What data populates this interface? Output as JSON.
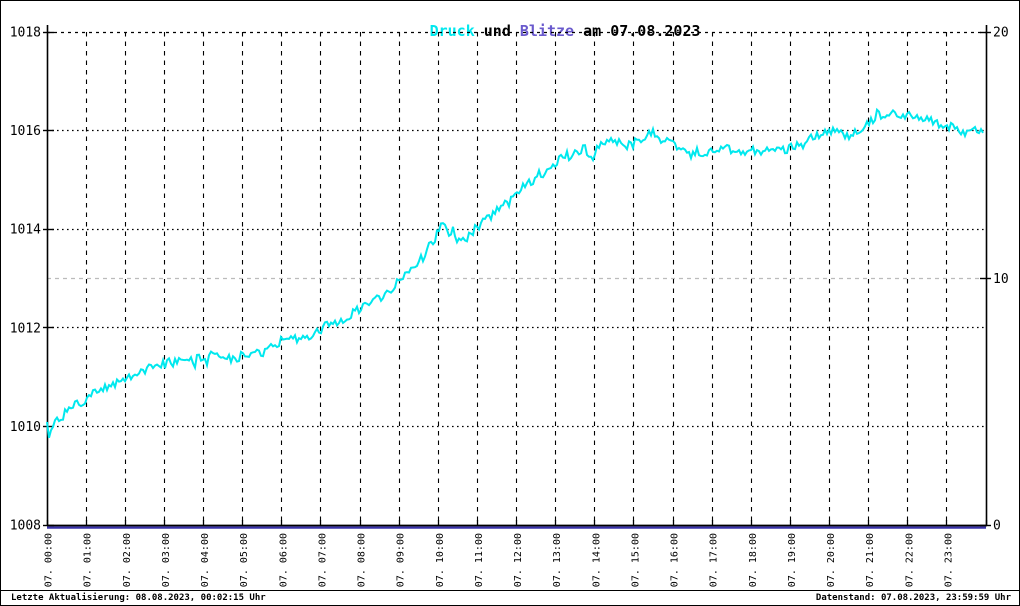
{
  "title": {
    "druck": "Druck",
    "und": " und ",
    "blitze": "Blitze",
    "date_suffix": " am 07.08.2023"
  },
  "footer": {
    "last_update": "Letzte Aktualisierung: 08.08.2023, 00:02:15 Uhr",
    "data_state": "Datenstand: 07.08.2023, 23:59:59 Uhr"
  },
  "colors": {
    "druck_accent": "#00E8EE",
    "blitze_accent": "#6A5ACD",
    "blitze_line": "#3832A8",
    "grid_major": "#000000",
    "grid_mid_gray": "#BBBBBB",
    "background": "#FFFFFF"
  },
  "chart_data": {
    "type": "line",
    "title": "Druck und Blitze am 07.08.2023",
    "x_range_hours": [
      0,
      24
    ],
    "x_hour_labels": [
      "07. 00:00",
      "07. 01:00",
      "07. 02:00",
      "07. 03:00",
      "07. 04:00",
      "07. 05:00",
      "07. 06:00",
      "07. 07:00",
      "07. 08:00",
      "07. 09:00",
      "07. 10:00",
      "07. 11:00",
      "07. 12:00",
      "07. 13:00",
      "07. 14:00",
      "07. 15:00",
      "07. 16:00",
      "07. 17:00",
      "07. 18:00",
      "07. 19:00",
      "07. 20:00",
      "07. 21:00",
      "07. 22:00",
      "07. 23:00"
    ],
    "y_left": {
      "range": [
        1008,
        1018
      ],
      "ticks": [
        1008,
        1010,
        1012,
        1014,
        1016,
        1018
      ]
    },
    "y_right": {
      "range": [
        0,
        20
      ],
      "ticks": [
        0,
        10,
        20
      ]
    },
    "grid": {
      "horizontal": "dotted-black",
      "vertical": "dashed-black-hourly",
      "right_mid_10": "dashed-light-gray"
    },
    "legend_position": "none",
    "noise_amplitude_hpa": 0.09,
    "series": [
      {
        "name": "Druck",
        "axis": "left",
        "color": "#00E8EE",
        "style": "noisy-line",
        "x_hours": [
          0,
          0.08,
          0.2,
          0.5,
          0.75,
          1.0,
          1.25,
          1.5,
          1.75,
          2.0,
          2.25,
          2.5,
          2.75,
          3.0,
          3.25,
          3.5,
          3.75,
          4.0,
          4.25,
          4.5,
          4.75,
          5.0,
          5.25,
          5.5,
          5.75,
          6.0,
          6.25,
          6.5,
          6.75,
          7.0,
          7.1,
          7.25,
          7.5,
          7.75,
          8.0,
          8.25,
          8.5,
          8.75,
          9.0,
          9.25,
          9.5,
          9.75,
          10.0,
          10.15,
          10.3,
          10.6,
          10.75,
          11.0,
          11.25,
          11.5,
          11.75,
          12.0,
          12.25,
          12.5,
          12.75,
          13.0,
          13.25,
          13.5,
          13.75,
          13.95,
          14.1,
          14.25,
          14.5,
          14.75,
          15.0,
          15.25,
          15.5,
          15.75,
          16.0,
          16.25,
          16.5,
          16.75,
          17.0,
          17.25,
          17.5,
          17.75,
          18.0,
          18.25,
          18.5,
          18.75,
          19.0,
          19.25,
          19.5,
          19.75,
          20.0,
          20.2,
          20.4,
          20.6,
          20.8,
          21.0,
          21.15,
          21.4,
          21.6,
          21.8,
          22.0,
          22.25,
          22.5,
          22.75,
          23.0,
          23.25,
          23.5,
          23.75,
          24.0
        ],
        "values": [
          1010.0,
          1009.82,
          1010.05,
          1010.3,
          1010.45,
          1010.55,
          1010.7,
          1010.8,
          1010.85,
          1010.95,
          1011.05,
          1011.15,
          1011.25,
          1011.25,
          1011.3,
          1011.42,
          1011.35,
          1011.4,
          1011.45,
          1011.4,
          1011.35,
          1011.45,
          1011.5,
          1011.5,
          1011.6,
          1011.7,
          1011.75,
          1011.8,
          1011.85,
          1011.95,
          1012.15,
          1012.1,
          1012.15,
          1012.25,
          1012.4,
          1012.55,
          1012.6,
          1012.75,
          1013.0,
          1013.2,
          1013.35,
          1013.55,
          1013.95,
          1014.2,
          1013.9,
          1013.75,
          1013.85,
          1014.05,
          1014.2,
          1014.4,
          1014.55,
          1014.75,
          1014.9,
          1015.05,
          1015.1,
          1015.35,
          1015.5,
          1015.55,
          1015.65,
          1015.35,
          1015.7,
          1015.75,
          1015.8,
          1015.75,
          1015.8,
          1015.85,
          1015.95,
          1015.8,
          1015.7,
          1015.6,
          1015.6,
          1015.55,
          1015.6,
          1015.65,
          1015.6,
          1015.55,
          1015.6,
          1015.55,
          1015.6,
          1015.6,
          1015.65,
          1015.7,
          1015.8,
          1015.9,
          1016.0,
          1016.05,
          1015.8,
          1015.95,
          1016.05,
          1016.15,
          1016.35,
          1016.3,
          1016.35,
          1016.3,
          1016.35,
          1016.3,
          1016.25,
          1016.15,
          1016.1,
          1016.05,
          1015.95,
          1016.0,
          1016.0
        ]
      },
      {
        "name": "Blitze",
        "axis": "right",
        "color": "#3832A8",
        "style": "line",
        "x_hours": [
          0,
          24
        ],
        "values": [
          0,
          0
        ]
      }
    ]
  }
}
